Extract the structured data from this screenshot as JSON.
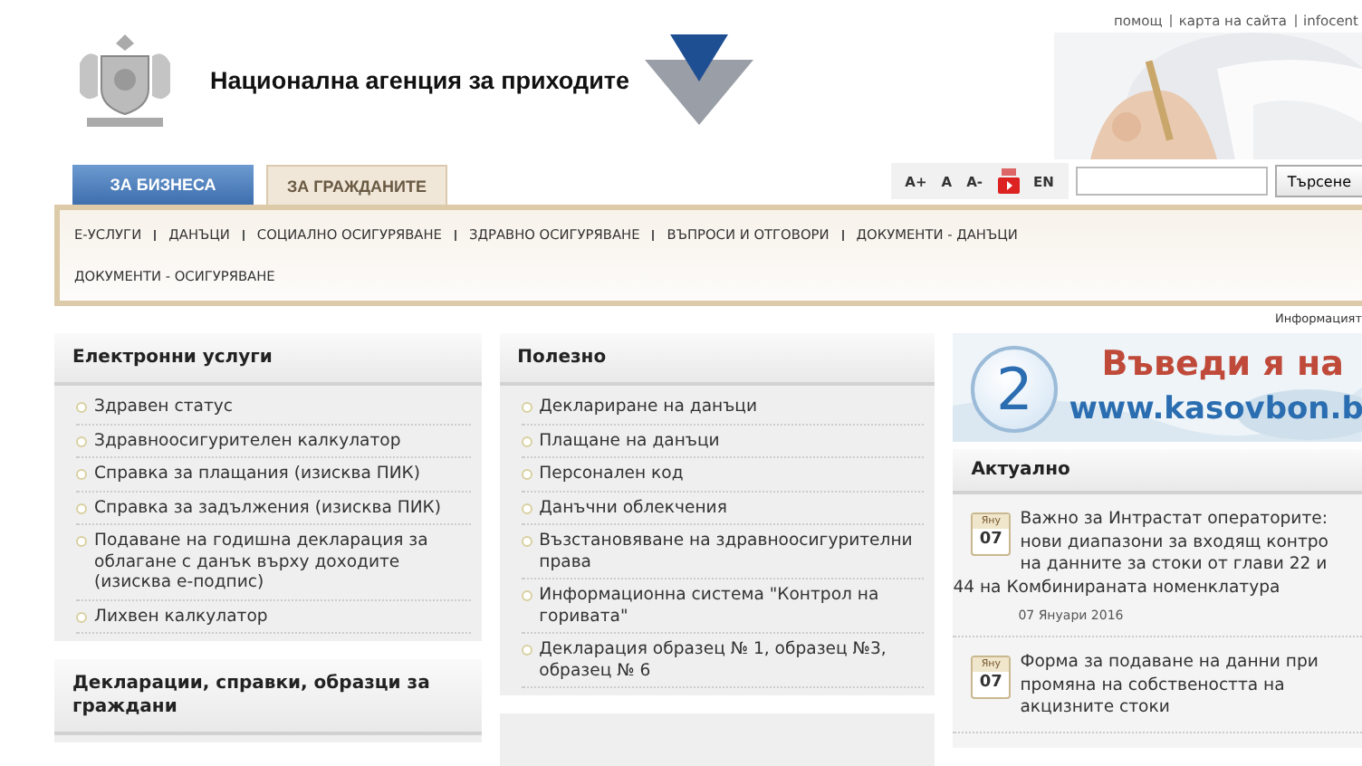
{
  "header": {
    "title": "Национална агенция за приходите",
    "utility_links": [
      "помощ",
      "карта на сайта",
      "infocent"
    ]
  },
  "audience_tabs": [
    {
      "label": "ЗА БИЗНЕСА",
      "selected": false
    },
    {
      "label": "ЗА ГРАЖДАНИТЕ",
      "selected": true
    }
  ],
  "tools": {
    "font_buttons": [
      "A+",
      "A",
      "A-"
    ],
    "language": "EN",
    "search_button": "Търсене"
  },
  "main_nav": [
    [
      "Е-УСЛУГИ",
      "ДАНЪЦИ",
      "СОЦИАЛНО ОСИГУРЯВАНЕ",
      "ЗДРАВНО ОСИГУРЯВАНЕ",
      "ВЪПРОСИ И ОТГОВОРИ",
      "ДОКУМЕНТИ - ДАНЪЦИ"
    ],
    [
      "ДОКУМЕНТИ - ОСИГУРЯВАНЕ"
    ]
  ],
  "info_note": "Информацият",
  "left_panels": [
    {
      "title": "Електронни услуги",
      "items": [
        "Здравен статус",
        "Здравноосигурителен калкулатор",
        "Справка за плащания (изисква ПИК)",
        "Справка за задължения (изисква ПИК)",
        "Подаване на годишна декларация за облагане с данък върху доходите (изисква е-подпис)",
        "Лихвен калкулатор"
      ]
    },
    {
      "title": "Декларации, справки, образци за граждани"
    }
  ],
  "middle_panel": {
    "title": "Полезно",
    "items": [
      "Деклариране на данъци",
      "Плащане на данъци",
      "Персонален код",
      "Данъчни облекчения",
      "Възстановяване на здравноосигурителни права",
      "Информационна система \"Контрол на горивата\"",
      "Декларация образец № 1, образец №3, образец № 6"
    ]
  },
  "banner": {
    "number": "2",
    "headline": "Въведи я на",
    "url": "www.kasovbon.b"
  },
  "news": {
    "title": "Актуално",
    "items": [
      {
        "month": "Яну",
        "day": "07",
        "lines": [
          "Важно за Интрастат операторите:",
          "нови диапазони за входящ контро",
          "на данните за стоки от глави 22 и",
          "44 на Комбинираната номенклатура"
        ],
        "date": "07 Януари 2016"
      },
      {
        "month": "Яну",
        "day": "07",
        "lines": [
          "Форма за подаване на данни при",
          "промяна на собствеността на",
          "акцизните стоки"
        ]
      }
    ]
  }
}
